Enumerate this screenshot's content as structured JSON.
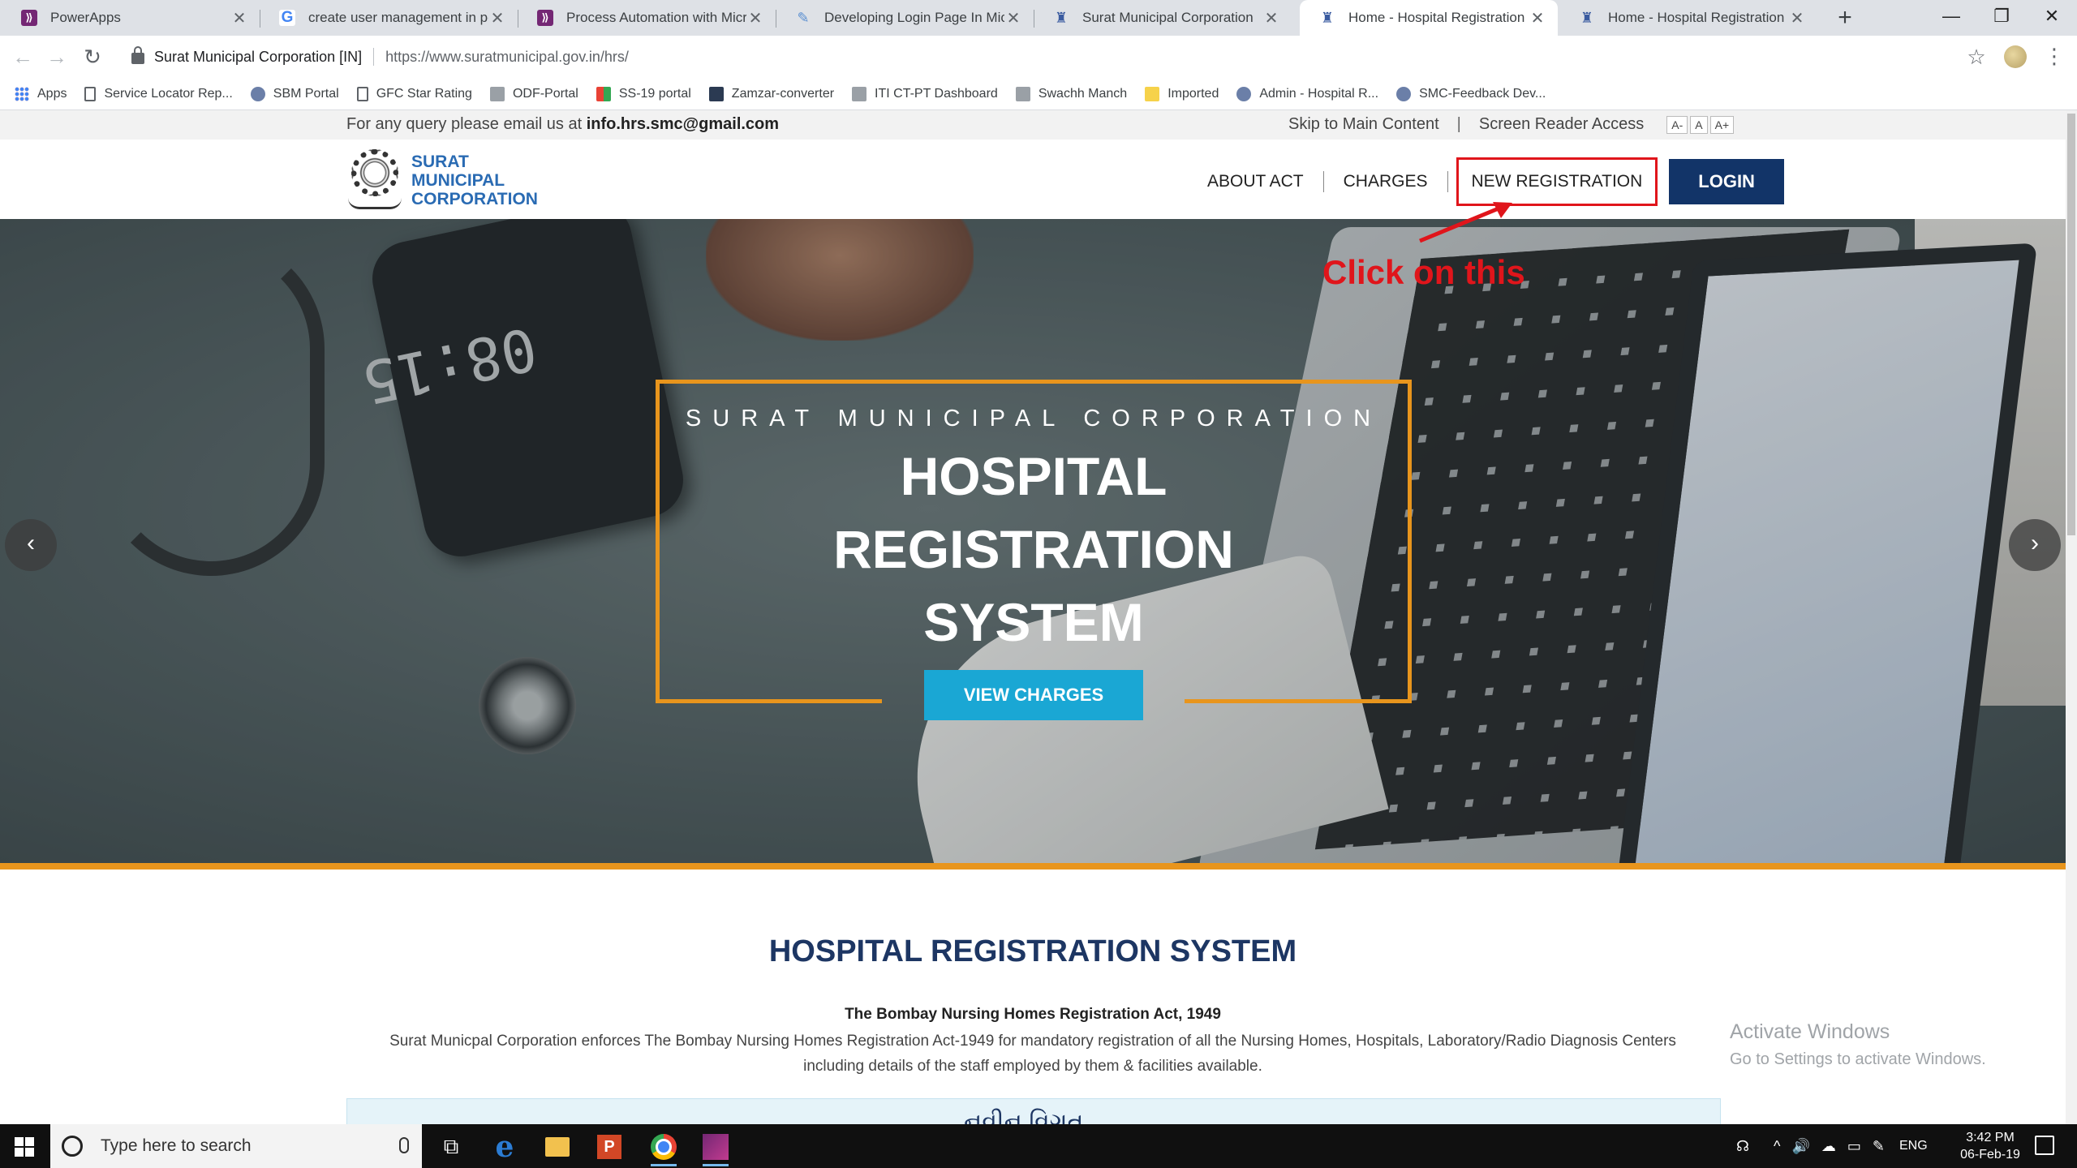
{
  "browser": {
    "tabs": [
      {
        "title": "PowerApps",
        "favicon": "powerapps-icon"
      },
      {
        "title": "create user management in powe",
        "favicon": "google-icon"
      },
      {
        "title": "Process Automation with Micros",
        "favicon": "powerapps-icon"
      },
      {
        "title": "Developing Login Page In Micros",
        "favicon": "dev-icon"
      },
      {
        "title": "Surat Municipal Corporation",
        "favicon": "smc-icon"
      },
      {
        "title": "Home - Hospital Registration Sys",
        "favicon": "smc-icon",
        "active": true
      },
      {
        "title": "Home - Hospital Registration Sys",
        "favicon": "smc-icon"
      }
    ],
    "site_identity": "Surat Municipal Corporation [IN]",
    "url": "https://www.suratmunicipal.gov.in/hrs/",
    "bookmarks": [
      {
        "label": "Apps",
        "icon": "apps-grid-icon"
      },
      {
        "label": "Service Locator Rep...",
        "icon": "page-icon"
      },
      {
        "label": "SBM Portal",
        "icon": "logo-icon"
      },
      {
        "label": "GFC Star Rating",
        "icon": "page-icon"
      },
      {
        "label": "ODF-Portal",
        "icon": "doc-icon"
      },
      {
        "label": "SS-19 portal",
        "icon": "ss-icon"
      },
      {
        "label": "Zamzar-converter",
        "icon": "zamzar-icon"
      },
      {
        "label": "ITI CT-PT Dashboard",
        "icon": "gray-icon"
      },
      {
        "label": "Swachh Manch",
        "icon": "gray-icon"
      },
      {
        "label": "Imported",
        "icon": "folder-icon"
      },
      {
        "label": "Admin - Hospital R...",
        "icon": "smc-icon"
      },
      {
        "label": "SMC-Feedback Dev...",
        "icon": "smc-icon"
      }
    ]
  },
  "infobar": {
    "query_prefix": "For any query please email us at",
    "email": "info.hrs.smc@gmail.com",
    "skip_link": "Skip to Main Content",
    "screen_reader": "Screen Reader Access",
    "font_sizes": [
      "A-",
      "A",
      "A+"
    ]
  },
  "header": {
    "logo_line1": "SURAT",
    "logo_line2": "MUNICIPAL",
    "logo_line3": "CORPORATION",
    "nav": {
      "about": "ABOUT ACT",
      "charges": "CHARGES",
      "new_registration": "NEW REGISTRATION",
      "login": "LOGIN"
    }
  },
  "hero": {
    "kicker": "SURAT MUNICIPAL CORPORATION",
    "title_line1": "HOSPITAL",
    "title_line2": "REGISTRATION",
    "title_line3": "SYSTEM",
    "button": "VIEW CHARGES",
    "phone_clock": "08:15",
    "prev": "‹",
    "next": "›"
  },
  "annotation": {
    "callout": "Click on this",
    "color": "#e0151b"
  },
  "content": {
    "title": "HOSPITAL REGISTRATION SYSTEM",
    "act_title": "The Bombay Nursing Homes Registration Act, 1949",
    "act_text_line1": "Surat Municpal Corporation enforces The Bombay Nursing Homes Registration Act-1949 for mandatory registration of all the Nursing Homes, Hospitals, Laboratory/Radio Diagnosis Centers",
    "act_text_line2": "including details of the staff employed by them & facilities available.",
    "box_text": "નવીન વિગત"
  },
  "watermark": {
    "line1": "Activate Windows",
    "line2": "Go to Settings to activate Windows."
  },
  "taskbar": {
    "search_placeholder": "Type here to search",
    "lang": "ENG",
    "time": "3:42 PM",
    "date": "06-Feb-19"
  },
  "colors": {
    "accent_orange": "#e8951d",
    "navy": "#123468",
    "cyan_button": "#1aa7d4",
    "logo_blue": "#2a6bb3"
  }
}
